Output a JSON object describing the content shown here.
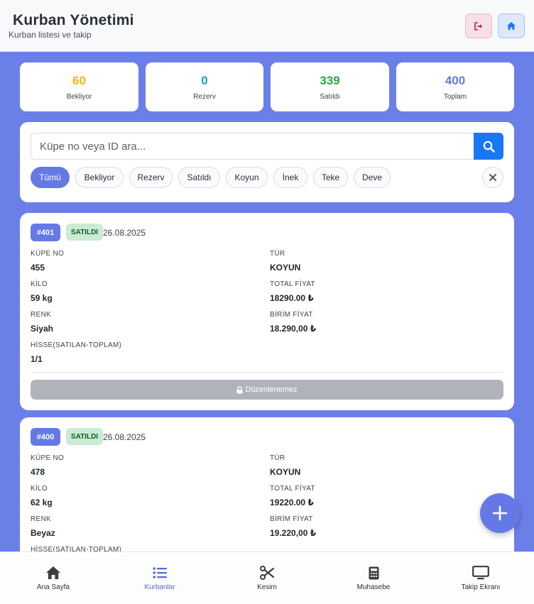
{
  "header": {
    "title": "Kurban Yönetimi",
    "subtitle": "Kurban listesi ve takip",
    "logout_icon": "sign-out-icon",
    "home_icon": "home-icon"
  },
  "stats": [
    {
      "value": "60",
      "label": "Bekliyor",
      "color": "#f2b705"
    },
    {
      "value": "0",
      "label": "Rezerv",
      "color": "#17a2b8"
    },
    {
      "value": "339",
      "label": "Satıldı",
      "color": "#28a745"
    },
    {
      "value": "400",
      "label": "Toplam",
      "color": "#6579e6"
    }
  ],
  "search": {
    "placeholder": "Küpe no veya ID ara...",
    "button_icon": "search-icon"
  },
  "filters": [
    "Tümü",
    "Bekliyor",
    "Rezerv",
    "Satıldı",
    "Koyun",
    "İnek",
    "Teke",
    "Deve"
  ],
  "active_filter": "Tümü",
  "records": [
    {
      "id": "#401",
      "status": "SATILDI",
      "date": "26.08.2025",
      "fields": {
        "kupe_no_label": "KÜPE NO",
        "kupe_no": "455",
        "tur_label": "TÜR",
        "tur": "KOYUN",
        "kilo_label": "KİLO",
        "kilo": "59 kg",
        "total_fiyat_label": "TOTAL FİYAT",
        "total_fiyat": "18290.00 ₺",
        "renk_label": "RENK",
        "renk": "Siyah",
        "birim_fiyat_label": "BİRİM FİYAT",
        "birim_fiyat": "18.290,00 ₺",
        "hisse_label": "HİSSE(SATILAN-TOPLAM)",
        "hisse": "1/1"
      },
      "action_label": "Düzenlenemez"
    },
    {
      "id": "#400",
      "status": "SATILDI",
      "date": "26.08.2025",
      "fields": {
        "kupe_no_label": "KÜPE NO",
        "kupe_no": "478",
        "tur_label": "TÜR",
        "tur": "KOYUN",
        "kilo_label": "KİLO",
        "kilo": "62 kg",
        "total_fiyat_label": "TOTAL FİYAT",
        "total_fiyat": "19220.00 ₺",
        "renk_label": "RENK",
        "renk": "Beyaz",
        "birim_fiyat_label": "BİRİM FİYAT",
        "birim_fiyat": "19.220,00 ₺",
        "hisse_label": "HİSSE(SATILAN-TOPLAM)"
      }
    }
  ],
  "fab_icon": "plus-icon",
  "bottom_nav": [
    {
      "label": "Ana Sayfa",
      "icon": "home-icon"
    },
    {
      "label": "Kurbanlar",
      "icon": "list-icon",
      "active": true
    },
    {
      "label": "Kesim",
      "icon": "scissors-icon"
    },
    {
      "label": "Muhasebe",
      "icon": "calculator-icon"
    },
    {
      "label": "Takip Ekranı",
      "icon": "monitor-icon"
    }
  ],
  "colors": {
    "background": "#6b7fe8",
    "accent": "#6579e6",
    "primary_button": "#1877f2",
    "sold_badge_bg": "#c9ecd3",
    "sold_badge_text": "#0e5a2b"
  }
}
